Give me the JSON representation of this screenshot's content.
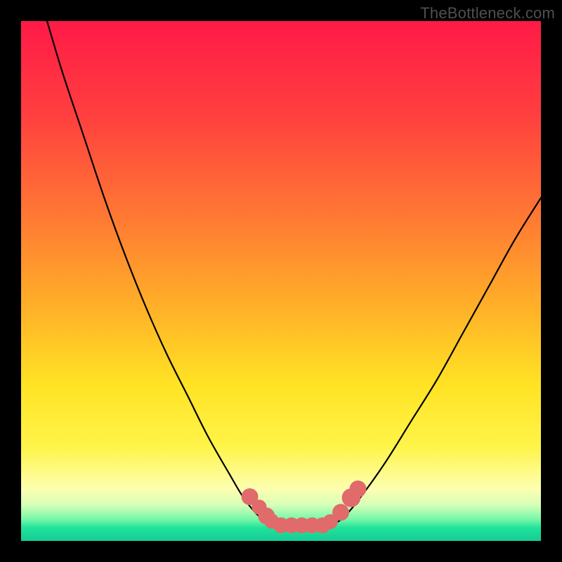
{
  "watermark": "TheBottleneck.com",
  "chart_data": {
    "type": "line",
    "title": "",
    "xlabel": "",
    "ylabel": "",
    "xlim": [
      0,
      100
    ],
    "ylim": [
      0,
      100
    ],
    "grid": false,
    "legend": false,
    "gradient_stops": [
      {
        "offset": 0,
        "color": "#ff1a47"
      },
      {
        "offset": 0.18,
        "color": "#ff3f3f"
      },
      {
        "offset": 0.38,
        "color": "#ff7a33"
      },
      {
        "offset": 0.55,
        "color": "#ffb028"
      },
      {
        "offset": 0.7,
        "color": "#ffe324"
      },
      {
        "offset": 0.82,
        "color": "#fff44a"
      },
      {
        "offset": 0.9,
        "color": "#fdffb0"
      },
      {
        "offset": 0.93,
        "color": "#d8ffb8"
      },
      {
        "offset": 0.958,
        "color": "#78f7a8"
      },
      {
        "offset": 0.975,
        "color": "#20e39a"
      },
      {
        "offset": 1.0,
        "color": "#15cc94"
      }
    ],
    "series": [
      {
        "name": "left-curve",
        "stroke": "#000000",
        "points": [
          {
            "x": 5,
            "y": 100
          },
          {
            "x": 8,
            "y": 90
          },
          {
            "x": 12,
            "y": 78
          },
          {
            "x": 16,
            "y": 66
          },
          {
            "x": 20,
            "y": 55
          },
          {
            "x": 24,
            "y": 45
          },
          {
            "x": 28,
            "y": 36
          },
          {
            "x": 32,
            "y": 28
          },
          {
            "x": 36,
            "y": 20
          },
          {
            "x": 40,
            "y": 13
          },
          {
            "x": 43,
            "y": 8
          },
          {
            "x": 46,
            "y": 4.5
          },
          {
            "x": 48,
            "y": 3.3
          },
          {
            "x": 50,
            "y": 3.0
          }
        ]
      },
      {
        "name": "right-curve",
        "stroke": "#000000",
        "points": [
          {
            "x": 58,
            "y": 3.0
          },
          {
            "x": 60,
            "y": 3.3
          },
          {
            "x": 62,
            "y": 4.5
          },
          {
            "x": 65,
            "y": 8
          },
          {
            "x": 70,
            "y": 15
          },
          {
            "x": 75,
            "y": 23
          },
          {
            "x": 80,
            "y": 31
          },
          {
            "x": 85,
            "y": 40
          },
          {
            "x": 90,
            "y": 49
          },
          {
            "x": 95,
            "y": 58
          },
          {
            "x": 100,
            "y": 66
          }
        ]
      },
      {
        "name": "bottom-flat",
        "stroke": "#e16a6a",
        "points": [
          {
            "x": 50,
            "y": 3.0
          },
          {
            "x": 52,
            "y": 3.0
          },
          {
            "x": 54,
            "y": 3.0
          },
          {
            "x": 56,
            "y": 3.0
          },
          {
            "x": 58,
            "y": 3.0
          }
        ]
      }
    ],
    "markers": [
      {
        "x": 44.0,
        "y": 8.5,
        "r": 1.2,
        "color": "#e16a6a"
      },
      {
        "x": 45.8,
        "y": 6.5,
        "r": 1.0,
        "color": "#e16a6a"
      },
      {
        "x": 47.2,
        "y": 4.8,
        "r": 1.2,
        "color": "#e16a6a"
      },
      {
        "x": 48.2,
        "y": 3.8,
        "r": 1.0,
        "color": "#e16a6a"
      },
      {
        "x": 50.0,
        "y": 3.0,
        "r": 1.1,
        "color": "#e16a6a"
      },
      {
        "x": 52.0,
        "y": 3.0,
        "r": 1.1,
        "color": "#e16a6a"
      },
      {
        "x": 54.0,
        "y": 3.0,
        "r": 1.1,
        "color": "#e16a6a"
      },
      {
        "x": 56.0,
        "y": 3.0,
        "r": 1.1,
        "color": "#e16a6a"
      },
      {
        "x": 58.0,
        "y": 3.0,
        "r": 1.1,
        "color": "#e16a6a"
      },
      {
        "x": 59.5,
        "y": 3.7,
        "r": 1.0,
        "color": "#e16a6a"
      },
      {
        "x": 61.5,
        "y": 5.5,
        "r": 1.2,
        "color": "#e16a6a"
      },
      {
        "x": 63.5,
        "y": 8.3,
        "r": 1.4,
        "color": "#e16a6a"
      },
      {
        "x": 64.8,
        "y": 10.0,
        "r": 1.2,
        "color": "#e16a6a"
      }
    ]
  }
}
